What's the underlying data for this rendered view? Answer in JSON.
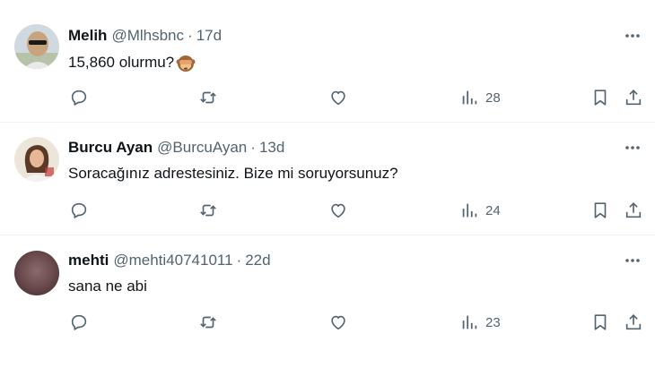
{
  "tweets": [
    {
      "name": "Melih",
      "handle": "@Mlhsbnc",
      "separator": "·",
      "time": "17d",
      "text": "15,860 olurmu?",
      "emoji": "see-no-evil-monkey",
      "views": "28",
      "avatar_color": "#c9d6de"
    },
    {
      "name": "Burcu Ayan",
      "handle": "@BurcuAyan",
      "separator": "·",
      "time": "13d",
      "text": "Soracağınız adrestesiniz. Bize mi soruyorsunuz?",
      "views": "24",
      "avatar_color": "#e8e2d6"
    },
    {
      "name": "mehti",
      "handle": "@mehti40741011",
      "separator": "·",
      "time": "22d",
      "text": "sana ne abi",
      "views": "23",
      "avatar_color": "#6b4b4e"
    }
  ],
  "colors": {
    "text_primary": "#0f1419",
    "text_secondary": "#536471",
    "divider": "#eff3f4"
  },
  "icons": [
    "reply-icon",
    "repost-icon",
    "like-icon",
    "views-icon",
    "bookmark-icon",
    "share-icon",
    "more-icon"
  ]
}
